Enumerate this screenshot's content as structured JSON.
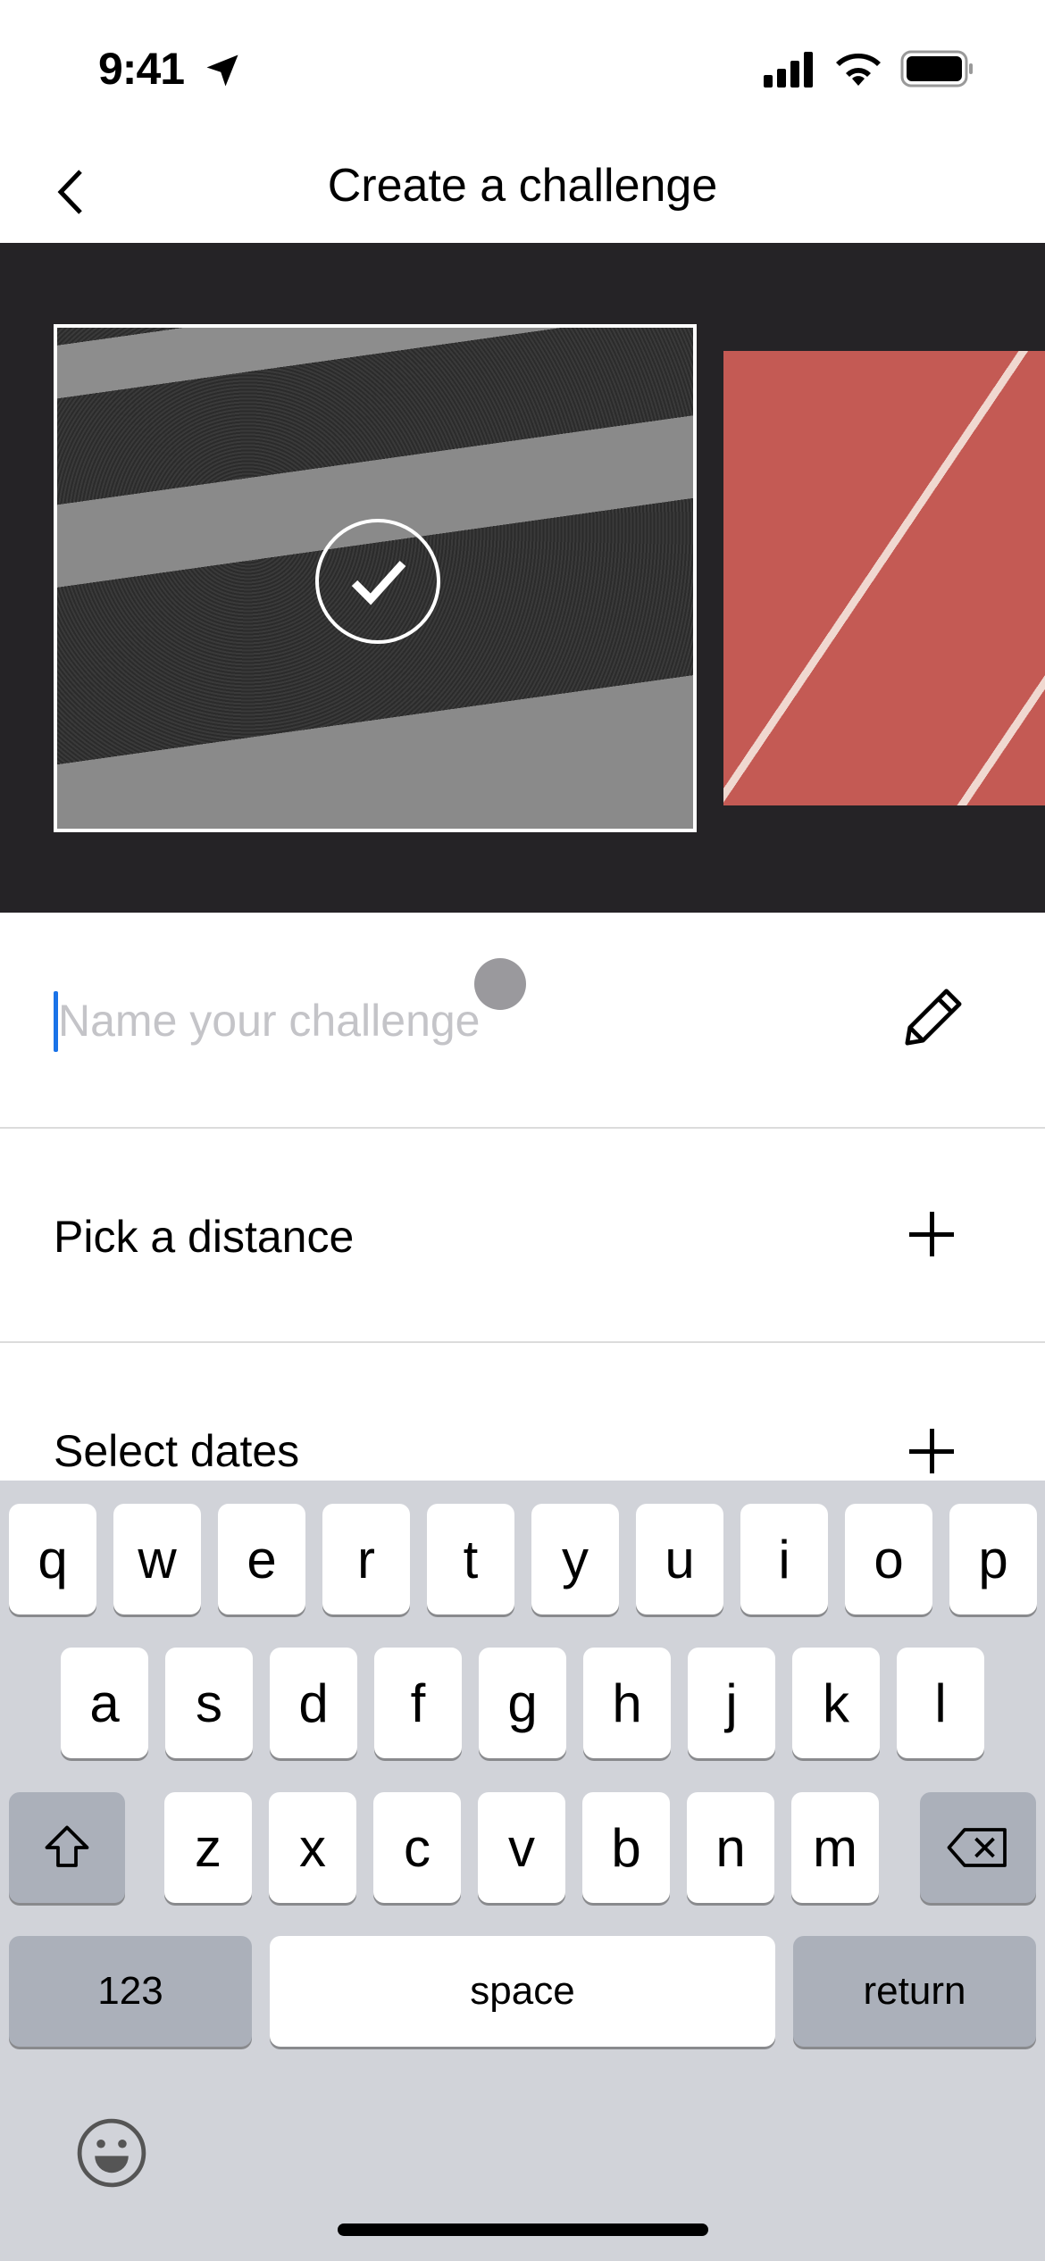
{
  "status_bar": {
    "time": "9:41"
  },
  "nav": {
    "title": "Create a challenge"
  },
  "form": {
    "name_placeholder": "Name your challenge",
    "name_value": "",
    "distance_label": "Pick a distance",
    "dates_label": "Select dates"
  },
  "colors": {
    "cursor": "#1a73e8",
    "band": "#252326",
    "track": "#c45a54",
    "keyboard": "#d1d3d9"
  },
  "keyboard": {
    "row1": [
      "q",
      "w",
      "e",
      "r",
      "t",
      "y",
      "u",
      "i",
      "o",
      "p"
    ],
    "row2": [
      "a",
      "s",
      "d",
      "f",
      "g",
      "h",
      "j",
      "k",
      "l"
    ],
    "row3": [
      "z",
      "x",
      "c",
      "v",
      "b",
      "n",
      "m"
    ],
    "numbers": "123",
    "space": "space",
    "return": "return"
  }
}
